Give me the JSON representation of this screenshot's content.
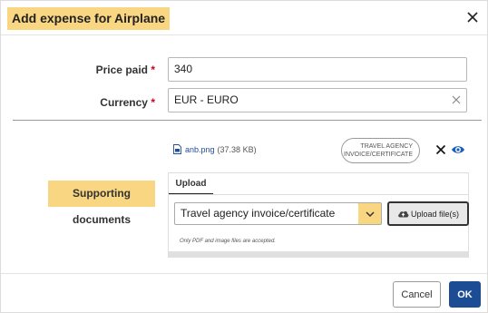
{
  "dialog": {
    "title": "Add expense for Airplane"
  },
  "form": {
    "price_paid": {
      "label": "Price paid",
      "required_mark": "*",
      "value": "340"
    },
    "currency": {
      "label": "Currency",
      "required_mark": "*",
      "value": "EUR - EURO"
    }
  },
  "documents": {
    "label": "Supporting documents",
    "uploaded_file": {
      "name": "anb.png",
      "size": "(37.38 KB)",
      "type_badge_line1": "TRAVEL AGENCY",
      "type_badge_line2": "INVOICE/CERTIFICATE"
    },
    "tab_label": "Upload",
    "document_type_selected": "Travel agency invoice/certificate",
    "upload_button_label": "Upload file(s)",
    "hint": "Only PDF and image files are accepted."
  },
  "footer": {
    "cancel_label": "Cancel",
    "ok_label": "OK"
  },
  "colors": {
    "highlight": "#f9d681",
    "primary": "#1b4c94",
    "required": "#d0021b",
    "link": "#1f4e9a"
  },
  "icons": [
    "close-icon",
    "clear-icon",
    "file-icon",
    "delete-icon",
    "eye-icon",
    "chevron-down-icon",
    "cloud-upload-icon"
  ]
}
